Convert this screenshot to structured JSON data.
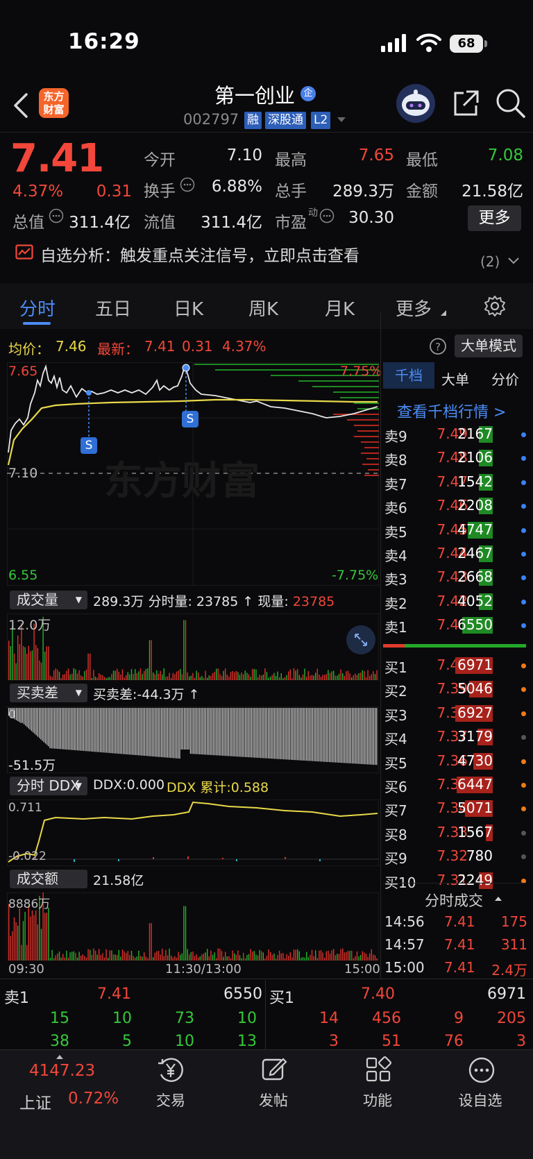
{
  "status_bar": {
    "time": "16:29",
    "battery": "68"
  },
  "header": {
    "logo_text": "东方财富",
    "stock_name": "第一创业",
    "badge": "企",
    "stock_code": "002797",
    "tags": [
      "融",
      "深股通",
      "L2"
    ]
  },
  "quote": {
    "price": "7.41",
    "change_pct": "4.37%",
    "change": "0.31",
    "items": [
      {
        "label": "今开",
        "value": "7.10",
        "color": "white"
      },
      {
        "label": "最高",
        "value": "7.65",
        "color": "red"
      },
      {
        "label": "最低",
        "value": "7.08",
        "color": "green"
      },
      {
        "label": "换手",
        "value": "6.88%",
        "color": "white"
      },
      {
        "label": "总手",
        "value": "289.3万",
        "color": "white"
      },
      {
        "label": "金额",
        "value": "21.58亿",
        "color": "white"
      },
      {
        "label": "总值",
        "value": "311.4亿",
        "color": "white"
      },
      {
        "label": "流值",
        "value": "311.4亿",
        "color": "white"
      },
      {
        "label": "市盈",
        "value": "30.30",
        "color": "white"
      }
    ],
    "pe_superscript": "动",
    "more_label": "更多"
  },
  "alert": {
    "text": "自选分析：触发重点关注信号，立即点击查看",
    "count": "(2)"
  },
  "tabs": [
    "分时",
    "五日",
    "日K",
    "周K",
    "月K",
    "更多"
  ],
  "chart_header": {
    "avg_label": "均价：",
    "avg_value": "7.46",
    "latest_label": "最新：",
    "latest_value": "7.41",
    "latest_change": "0.31",
    "latest_pct": "4.37%",
    "large_order_mode": "大单模式"
  },
  "main_chart": {
    "y_top": "7.65",
    "y_mid": "7.10",
    "y_bottom": "6.55",
    "pct_top": "7.75%",
    "pct_bottom": "-7.75%",
    "signal": "S"
  },
  "volume": {
    "label": "成交量",
    "summary_total": "289.3万",
    "summary_fen_label": "分时量:",
    "summary_fen": "23785",
    "arrow": "↑",
    "xianliang_label": "现量:",
    "xianliang": "23785",
    "y_top": "12.0万"
  },
  "maimaicha": {
    "label": "买卖差",
    "summary": "买卖差:-44.3万 ↑",
    "y_top": "0",
    "y_bottom": "-51.5万"
  },
  "ddx": {
    "label": "分时 DDX",
    "ddx_text": "DDX:0.000",
    "ddx_cum": "DDX 累计:0.588",
    "y_top": "0.711",
    "y_bottom": "-0.022"
  },
  "amount": {
    "label": "成交额",
    "summary": "21.58亿",
    "y_top": "8886万"
  },
  "time_axis": [
    "09:30",
    "11:30/13:00",
    "15:00"
  ],
  "order_book": {
    "tabs": [
      "千档",
      "大单",
      "分价"
    ],
    "view_link": "查看千档行情 >",
    "asks": [
      {
        "label": "卖9",
        "price": "7.49",
        "vol": "2167"
      },
      {
        "label": "卖8",
        "price": "7.48",
        "vol": "2106"
      },
      {
        "label": "卖7",
        "price": "7.47",
        "vol": "1542"
      },
      {
        "label": "卖6",
        "price": "7.46",
        "vol": "2208"
      },
      {
        "label": "卖5",
        "price": "7.45",
        "vol": "4747"
      },
      {
        "label": "卖4",
        "price": "7.44",
        "vol": "2467"
      },
      {
        "label": "卖3",
        "price": "7.43",
        "vol": "2668"
      },
      {
        "label": "卖2",
        "price": "7.42",
        "vol": "4052"
      },
      {
        "label": "卖1",
        "price": "7.41",
        "vol": "6550"
      }
    ],
    "bids": [
      {
        "label": "买1",
        "price": "7.40",
        "vol": "6971"
      },
      {
        "label": "买2",
        "price": "7.39",
        "vol": "5046"
      },
      {
        "label": "买3",
        "price": "7.38",
        "vol": "6927"
      },
      {
        "label": "买4",
        "price": "7.37",
        "vol": "3179"
      },
      {
        "label": "买5",
        "price": "7.36",
        "vol": "4730"
      },
      {
        "label": "买6",
        "price": "7.35",
        "vol": "6447"
      },
      {
        "label": "买7",
        "price": "7.34",
        "vol": "5071"
      },
      {
        "label": "买8",
        "price": "7.33",
        "vol": "1567"
      },
      {
        "label": "买9",
        "price": "7.32",
        "vol": "780"
      },
      {
        "label": "买10",
        "price": "7.31",
        "vol": "2249"
      }
    ],
    "trades_title": "分时成交",
    "trades": [
      {
        "time": "14:56",
        "price": "7.41",
        "vol": "175"
      },
      {
        "time": "14:57",
        "price": "7.41",
        "vol": "311"
      },
      {
        "time": "15:00",
        "price": "7.41",
        "vol": "2.4万"
      }
    ]
  },
  "queue": {
    "sell_label": "卖1",
    "sell_price": "7.41",
    "sell_vol": "6550",
    "buy_label": "买1",
    "buy_price": "7.40",
    "buy_vol": "6971",
    "sell_rows": [
      [
        "15",
        "10",
        "73",
        "10"
      ],
      [
        "38",
        "5",
        "10",
        "13"
      ]
    ],
    "buy_rows": [
      [
        "14",
        "456",
        "9",
        "205"
      ],
      [
        "3",
        "51",
        "76",
        "3"
      ]
    ]
  },
  "bottom_nav": {
    "index_value": "4147.23",
    "index_name": "上证",
    "index_pct": "0.72%",
    "items": [
      "交易",
      "发帖",
      "功能",
      "设自选"
    ]
  }
}
